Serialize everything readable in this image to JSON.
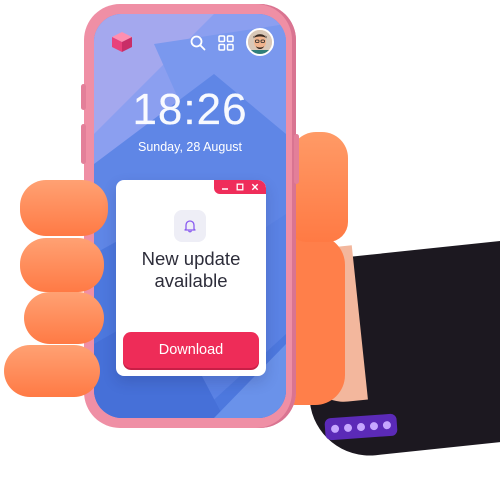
{
  "lockscreen": {
    "time": "18:26",
    "date": "Sunday, 28 August"
  },
  "statusbar": {
    "logo_icon": "cube-logo-icon",
    "search_icon": "search-icon",
    "apps_icon": "apps-grid-icon",
    "avatar_icon": "user-avatar"
  },
  "dialog": {
    "title_line1": "New update",
    "title_line2": "available",
    "icon": "bell-icon",
    "download_label": "Download",
    "controls": [
      "minimize-icon",
      "maximize-icon",
      "close-icon"
    ]
  },
  "colors": {
    "phone_body": "#ef8fa5",
    "accent": "#ee2c58",
    "wallpaper": "#6b8de8",
    "sleeve": "#1c1820",
    "hand": "#ff7f4a"
  }
}
